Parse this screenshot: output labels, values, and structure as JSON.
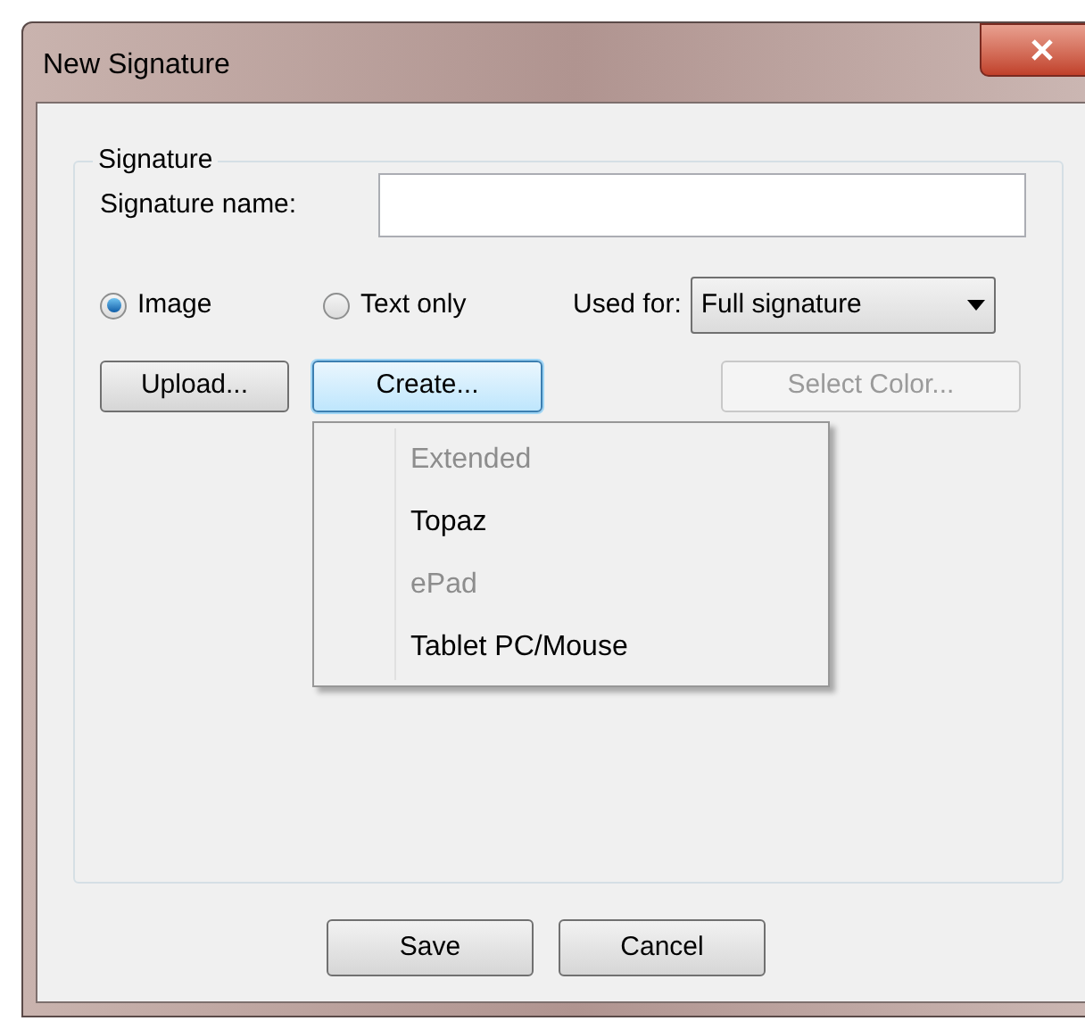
{
  "window": {
    "title": "New Signature"
  },
  "group": {
    "legend": "Signature",
    "name_label": "Signature name:"
  },
  "radios": [
    {
      "label": "Image",
      "selected": true
    },
    {
      "label": "Text only",
      "selected": false
    }
  ],
  "used_for": {
    "label": "Used for:",
    "value": "Full signature"
  },
  "buttons": [
    {
      "label": "Upload...",
      "focused": false,
      "disabled": false
    },
    {
      "label": "Create...",
      "focused": true,
      "disabled": false
    },
    {
      "label": "Select Color...",
      "focused": false,
      "disabled": true
    }
  ],
  "menu": [
    {
      "label": "Extended",
      "disabled": true
    },
    {
      "label": "Topaz",
      "disabled": false
    },
    {
      "label": "ePad",
      "disabled": true
    },
    {
      "label": "Tablet PC/Mouse",
      "disabled": false
    }
  ],
  "footer_buttons": [
    "Save",
    "Cancel"
  ]
}
